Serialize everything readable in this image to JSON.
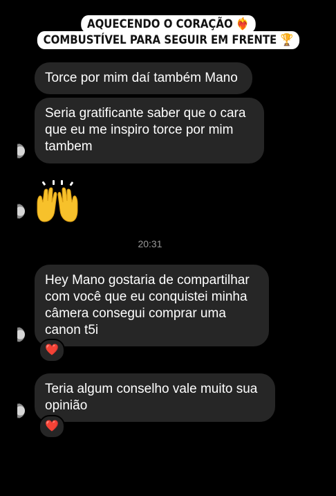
{
  "captions": [
    "AQUECENDO O CORAÇÃO ❤️‍🔥",
    "COMBUSTÍVEL PARA SEGUIR EM FRENTE 🏆"
  ],
  "messages": [
    {
      "text": "Torce por mim daí também Mano"
    },
    {
      "text": "Seria gratificante saber que o cara que eu me inspiro torce por mim tambem"
    },
    {
      "text": "Hey Mano gostaria de compartilhar com você que eu conquistei minha câmera consegui comprar uma canon t5i",
      "reaction": "❤️"
    },
    {
      "text": "Teria algum conselho vale muito sua opinião",
      "reaction": "❤️"
    }
  ],
  "emoji_message": {
    "emoji": "raising-hands-icon"
  },
  "timestamp": "20:31",
  "colors": {
    "background": "#000000",
    "bubble": "#262626",
    "text": "#ffffff",
    "timestamp": "#9a9a9a",
    "caption_bg": "#ffffff",
    "heart": "#e0245e"
  }
}
